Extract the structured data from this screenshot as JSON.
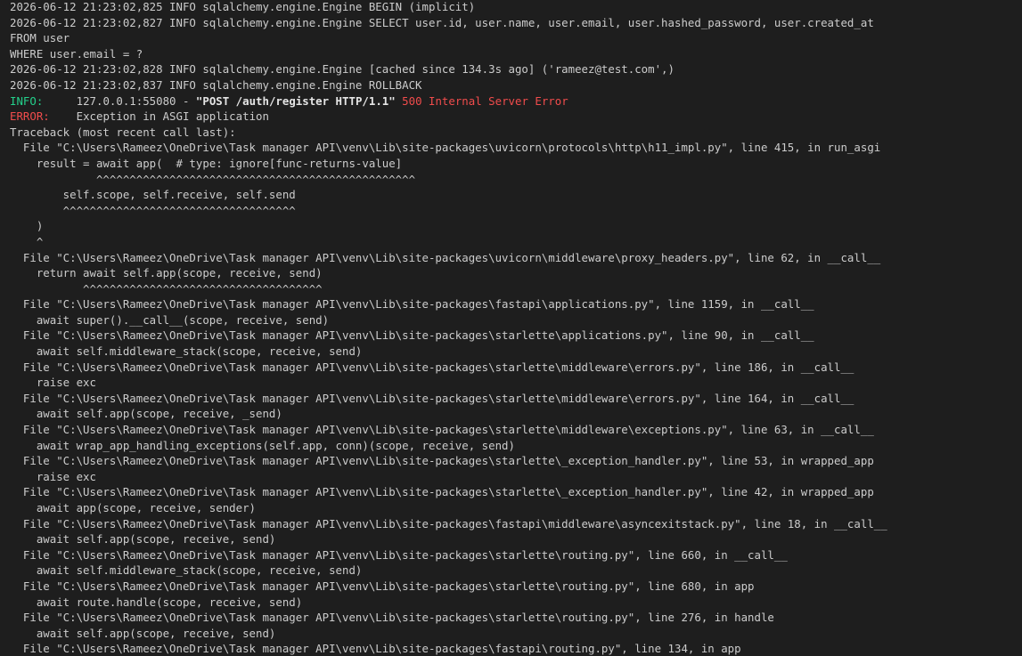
{
  "colors": {
    "background": "#1e1e1e",
    "text": "#cccccc",
    "info_label": "#23d18b",
    "error_label": "#f14c4c",
    "status_error": "#f14c4c"
  },
  "lines": [
    "2026-06-12 21:23:02,825 INFO sqlalchemy.engine.Engine BEGIN (implicit)",
    "2026-06-12 21:23:02,827 INFO sqlalchemy.engine.Engine SELECT user.id, user.name, user.email, user.hashed_password, user.created_at",
    "FROM user",
    "WHERE user.email = ?",
    "2026-06-12 21:23:02,828 INFO sqlalchemy.engine.Engine [cached since 134.3s ago] ('rameez@test.com',)",
    "2026-06-12 21:23:02,837 INFO sqlalchemy.engine.Engine ROLLBACK"
  ],
  "access_log": {
    "label": "INFO:",
    "pad": "     ",
    "client": "127.0.0.1:55080 - ",
    "request": "\"POST /auth/register HTTP/1.1\"",
    "space": " ",
    "status": "500 Internal Server Error"
  },
  "error_log": {
    "label": "ERROR:",
    "pad": "    ",
    "message": "Exception in ASGI application"
  },
  "traceback": [
    "Traceback (most recent call last):",
    "  File \"C:\\Users\\Rameez\\OneDrive\\Task manager API\\venv\\Lib\\site-packages\\uvicorn\\protocols\\http\\h11_impl.py\", line 415, in run_asgi",
    "    result = await app(  # type: ignore[func-returns-value]",
    "             ^^^^^^^^^^^^^^^^^^^^^^^^^^^^^^^^^^^^^^^^^^^^^^^^",
    "        self.scope, self.receive, self.send",
    "        ^^^^^^^^^^^^^^^^^^^^^^^^^^^^^^^^^^^",
    "    )",
    "    ^",
    "  File \"C:\\Users\\Rameez\\OneDrive\\Task manager API\\venv\\Lib\\site-packages\\uvicorn\\middleware\\proxy_headers.py\", line 62, in __call__",
    "    return await self.app(scope, receive, send)",
    "           ^^^^^^^^^^^^^^^^^^^^^^^^^^^^^^^^^^^^",
    "  File \"C:\\Users\\Rameez\\OneDrive\\Task manager API\\venv\\Lib\\site-packages\\fastapi\\applications.py\", line 1159, in __call__",
    "    await super().__call__(scope, receive, send)",
    "  File \"C:\\Users\\Rameez\\OneDrive\\Task manager API\\venv\\Lib\\site-packages\\starlette\\applications.py\", line 90, in __call__",
    "    await self.middleware_stack(scope, receive, send)",
    "  File \"C:\\Users\\Rameez\\OneDrive\\Task manager API\\venv\\Lib\\site-packages\\starlette\\middleware\\errors.py\", line 186, in __call__",
    "    raise exc",
    "  File \"C:\\Users\\Rameez\\OneDrive\\Task manager API\\venv\\Lib\\site-packages\\starlette\\middleware\\errors.py\", line 164, in __call__",
    "    await self.app(scope, receive, _send)",
    "  File \"C:\\Users\\Rameez\\OneDrive\\Task manager API\\venv\\Lib\\site-packages\\starlette\\middleware\\exceptions.py\", line 63, in __call__",
    "    await wrap_app_handling_exceptions(self.app, conn)(scope, receive, send)",
    "  File \"C:\\Users\\Rameez\\OneDrive\\Task manager API\\venv\\Lib\\site-packages\\starlette\\_exception_handler.py\", line 53, in wrapped_app",
    "    raise exc",
    "  File \"C:\\Users\\Rameez\\OneDrive\\Task manager API\\venv\\Lib\\site-packages\\starlette\\_exception_handler.py\", line 42, in wrapped_app",
    "    await app(scope, receive, sender)",
    "  File \"C:\\Users\\Rameez\\OneDrive\\Task manager API\\venv\\Lib\\site-packages\\fastapi\\middleware\\asyncexitstack.py\", line 18, in __call__",
    "    await self.app(scope, receive, send)",
    "  File \"C:\\Users\\Rameez\\OneDrive\\Task manager API\\venv\\Lib\\site-packages\\starlette\\routing.py\", line 660, in __call__",
    "    await self.middleware_stack(scope, receive, send)",
    "  File \"C:\\Users\\Rameez\\OneDrive\\Task manager API\\venv\\Lib\\site-packages\\starlette\\routing.py\", line 680, in app",
    "    await route.handle(scope, receive, send)",
    "  File \"C:\\Users\\Rameez\\OneDrive\\Task manager API\\venv\\Lib\\site-packages\\starlette\\routing.py\", line 276, in handle",
    "    await self.app(scope, receive, send)",
    "  File \"C:\\Users\\Rameez\\OneDrive\\Task manager API\\venv\\Lib\\site-packages\\fastapi\\routing.py\", line 134, in app"
  ]
}
